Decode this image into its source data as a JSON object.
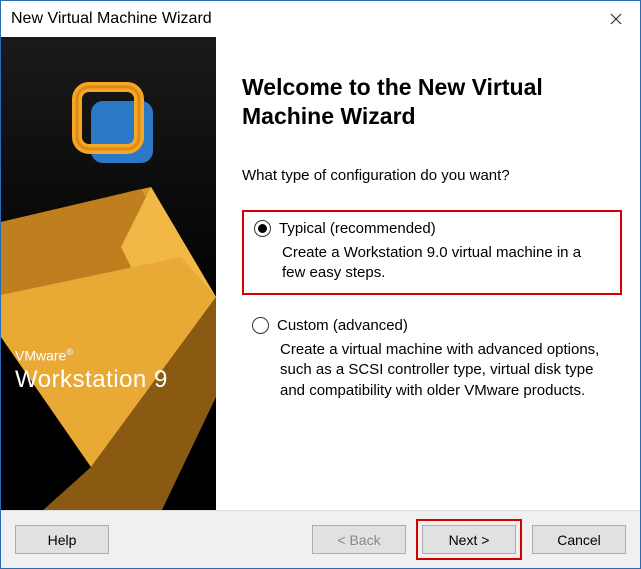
{
  "window": {
    "title": "New Virtual Machine Wizard"
  },
  "sidebar": {
    "brand_top": "VMware",
    "brand_reg": "®",
    "brand_product": "Workstation 9"
  },
  "main": {
    "heading": "Welcome to the New Virtual Machine Wizard",
    "question": "What type of configuration do you want?"
  },
  "options": {
    "typical": {
      "label": "Typical (recommended)",
      "desc": "Create a Workstation 9.0 virtual machine in a few easy steps."
    },
    "custom": {
      "label": "Custom (advanced)",
      "desc": "Create a virtual machine with advanced options, such as a SCSI controller type, virtual disk type and compatibility with older VMware products."
    }
  },
  "footer": {
    "help": "Help",
    "back": "< Back",
    "next": "Next >",
    "cancel": "Cancel"
  }
}
